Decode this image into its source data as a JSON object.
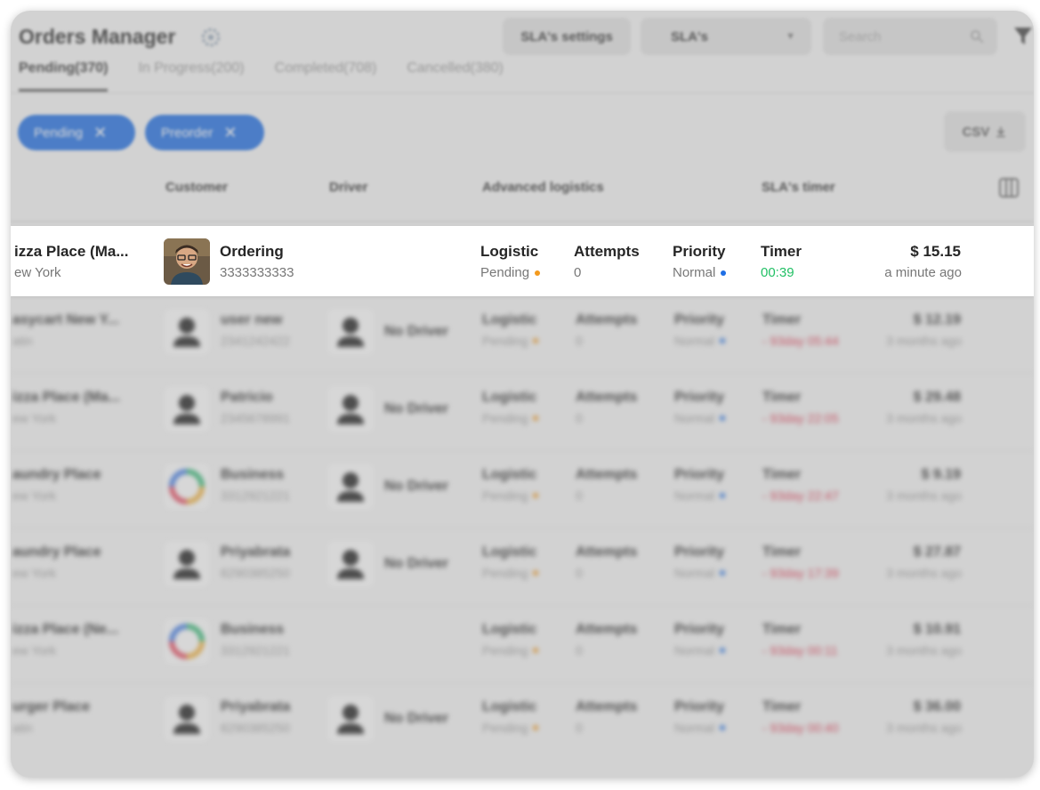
{
  "header": {
    "title": "Orders Manager",
    "sla_settings_label": "SLA's settings",
    "sla_select_value": "SLA's",
    "search_placeholder": "Search"
  },
  "tabs": [
    {
      "label": "Pending(370)",
      "active": true
    },
    {
      "label": "In Progress(200)",
      "active": false
    },
    {
      "label": "Completed(708)",
      "active": false
    },
    {
      "label": "Cancelled(380)",
      "active": false
    }
  ],
  "filters": {
    "chips": [
      "Pending",
      "Preorder"
    ],
    "csv_label": "CSV"
  },
  "columns": {
    "customer": "Customer",
    "driver": "Driver",
    "advanced_logistics": "Advanced logistics",
    "sla_timer": "SLA's timer"
  },
  "labels": {
    "logistic": "Logistic",
    "attempts": "Attempts",
    "priority": "Priority",
    "timer": "Timer"
  },
  "focused_order": {
    "store": "izza Place (Ma...",
    "city": "ew York",
    "customer_name": "Ordering",
    "customer_phone": "3333333333",
    "logistic_status": "Pending",
    "attempts": "0",
    "priority": "Normal",
    "timer": "00:39",
    "price": "$ 15.15",
    "time_ago": "a minute ago"
  },
  "orders": [
    {
      "store": "asycart New Y...",
      "city": "atin",
      "customer_name": "user new",
      "customer_phone": "2341242422",
      "avatar": "person-icon",
      "driver": "No Driver",
      "logistic_status": "Pending",
      "attempts": "0",
      "priority": "Normal",
      "timer": "- 93day 05:44",
      "price": "$ 12.19",
      "time_ago": "3 months ago"
    },
    {
      "store": "izza Place (Ma...",
      "city": "ew York",
      "customer_name": "Patricio",
      "customer_phone": "2345678991",
      "avatar": "person-icon",
      "driver": "No Driver",
      "logistic_status": "Pending",
      "attempts": "0",
      "priority": "Normal",
      "timer": "- 93day 22:05",
      "price": "$ 29.48",
      "time_ago": "3 months ago"
    },
    {
      "store": "aundry Place",
      "city": "ew York",
      "customer_name": "Business",
      "customer_phone": "3312921221",
      "avatar": "ring-logo-icon",
      "driver": "No Driver",
      "logistic_status": "Pending",
      "attempts": "0",
      "priority": "Normal",
      "timer": "- 93day 22:47",
      "price": "$ 9.19",
      "time_ago": "3 months ago"
    },
    {
      "store": "aundry Place",
      "city": "ew York",
      "customer_name": "Priyabrata",
      "customer_phone": "6290385250",
      "avatar": "person-icon",
      "driver": "No Driver",
      "logistic_status": "Pending",
      "attempts": "0",
      "priority": "Normal",
      "timer": "- 93day 17:39",
      "price": "$ 27.87",
      "time_ago": "3 months ago"
    },
    {
      "store": "izza Place (Ne...",
      "city": "ew York",
      "customer_name": "Business",
      "customer_phone": "3312921221",
      "avatar": "ring-logo-icon",
      "driver": "",
      "logistic_status": "Pending",
      "attempts": "0",
      "priority": "Normal",
      "timer": "- 93day 00:11",
      "price": "$ 10.91",
      "time_ago": "3 months ago"
    },
    {
      "store": "urger Place",
      "city": "atin",
      "customer_name": "Priyabrata",
      "customer_phone": "6290385250",
      "avatar": "person-icon",
      "driver": "No Driver",
      "logistic_status": "Pending",
      "attempts": "0",
      "priority": "Normal",
      "timer": "- 93day 00:40",
      "price": "$ 36.00",
      "time_ago": "3 months ago"
    }
  ],
  "colors": {
    "accent": "#1f6fe5",
    "pending_dot": "#f39a1e",
    "priority_dot": "#1f6fe5",
    "timer_overdue": "#e2344f",
    "timer_ok": "#22c065"
  }
}
